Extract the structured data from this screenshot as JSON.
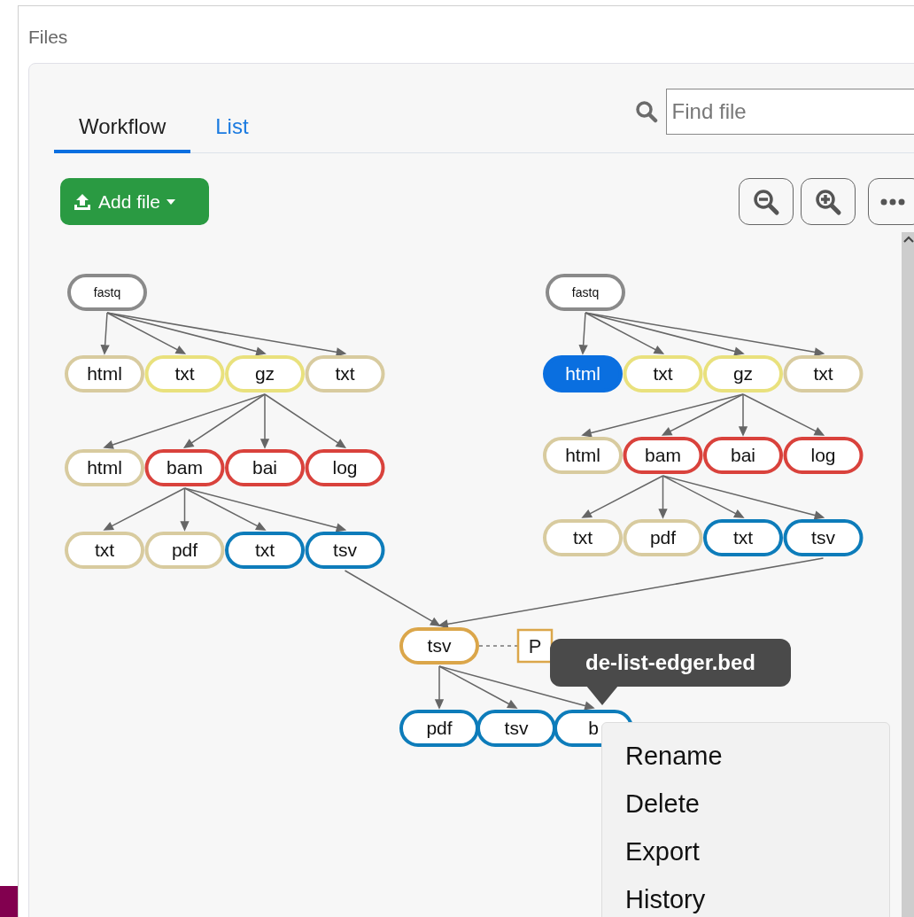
{
  "panel_title": "Files",
  "tabs": [
    {
      "label": "Workflow",
      "selected": true
    },
    {
      "label": "List",
      "selected": false
    }
  ],
  "search": {
    "placeholder": "Find file"
  },
  "add_button": {
    "label": "Add file"
  },
  "graphs": [
    {
      "label": "fastq",
      "color": "#8a8a8a",
      "selected": false,
      "children": [
        {
          "label": "html",
          "color": "#d8cb9f",
          "selected": false
        },
        {
          "label": "txt",
          "color": "#e9e17d",
          "selected": false
        },
        {
          "label": "gz",
          "color": "#e9e17d",
          "selected": false,
          "children": [
            {
              "label": "html",
              "color": "#d8cb9f",
              "selected": false
            },
            {
              "label": "bam",
              "color": "#d9423c",
              "selected": false,
              "children": [
                {
                  "label": "txt",
                  "color": "#d8cb9f",
                  "selected": false
                },
                {
                  "label": "pdf",
                  "color": "#d8cb9f",
                  "selected": false
                },
                {
                  "label": "txt",
                  "color": "#0d7cba",
                  "selected": false
                },
                {
                  "label": "tsv",
                  "color": "#0d7cba",
                  "selected": false
                }
              ]
            },
            {
              "label": "bai",
              "color": "#d9423c",
              "selected": false
            },
            {
              "label": "log",
              "color": "#d9423c",
              "selected": false
            }
          ]
        },
        {
          "label": "txt",
          "color": "#d8cb9f",
          "selected": false
        }
      ]
    },
    {
      "label": "fastq",
      "color": "#8a8a8a",
      "selected": false,
      "children": [
        {
          "label": "html",
          "selected": true
        },
        {
          "label": "txt",
          "color": "#e9e17d",
          "selected": false
        },
        {
          "label": "gz",
          "color": "#e9e17d",
          "selected": false,
          "children": [
            {
              "label": "html",
              "color": "#d8cb9f",
              "selected": false
            },
            {
              "label": "bam",
              "color": "#d9423c",
              "selected": false,
              "children": [
                {
                  "label": "txt",
                  "color": "#d8cb9f",
                  "selected": false
                },
                {
                  "label": "pdf",
                  "color": "#d8cb9f",
                  "selected": false
                },
                {
                  "label": "txt",
                  "color": "#0d7cba",
                  "selected": false
                },
                {
                  "label": "tsv",
                  "color": "#0d7cba",
                  "selected": false
                }
              ]
            },
            {
              "label": "bai",
              "color": "#d9423c",
              "selected": false
            },
            {
              "label": "log",
              "color": "#d9423c",
              "selected": false
            }
          ]
        },
        {
          "label": "txt",
          "color": "#d8cb9f",
          "selected": false
        }
      ]
    }
  ],
  "merged": {
    "label": "tsv",
    "color": "#dba64a",
    "selected": false,
    "note": "P",
    "children": [
      {
        "label": "pdf",
        "color": "#0d7cba",
        "selected": false
      },
      {
        "label": "tsv",
        "color": "#0d7cba",
        "selected": false
      },
      {
        "label": "b",
        "color": "#0d7cba",
        "selected": false
      }
    ]
  },
  "tooltip": "de-list-edger.bed",
  "context_menu": [
    "Rename",
    "Delete",
    "Export",
    "History"
  ]
}
